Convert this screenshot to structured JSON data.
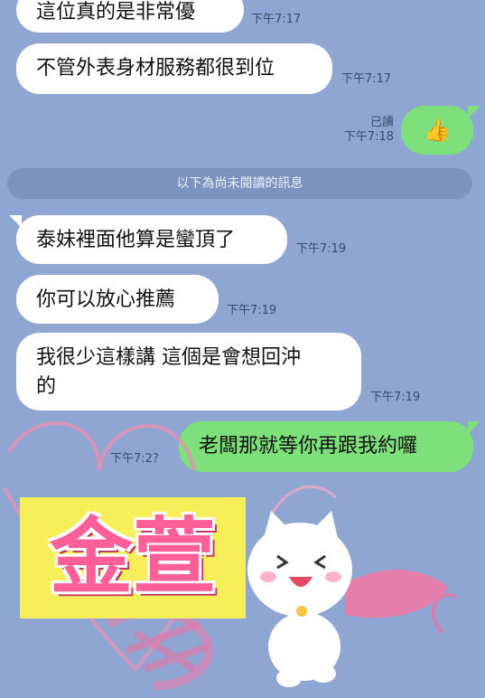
{
  "messages": [
    {
      "text": "這位真的是非常優",
      "time": "下午7:17"
    },
    {
      "text": "不管外表身材服務都很到位",
      "time": "下午7:17"
    },
    {
      "text": "👍",
      "read": "已讀",
      "time": "下午7:18"
    },
    {
      "text": "泰妹裡面他算是蠻頂了",
      "time": "下午7:19"
    },
    {
      "text": "你可以放心推薦",
      "time": "下午7:19"
    },
    {
      "line1": "我很少這樣講 這個是會想回沖",
      "line2": "的",
      "time": "下午7:19"
    },
    {
      "text": "老闆那就等你再跟我約囉",
      "time": "下午7:2?"
    }
  ],
  "divider": "以下為尚未閱讀的訊息",
  "overlay": {
    "caption": "金萱",
    "bg_color": "#f7ef5a",
    "text_color": "#ff5f97"
  },
  "colors": {
    "background": "#8fa6d3",
    "outgoing": "#7ee07a",
    "incoming": "#ffffff"
  }
}
